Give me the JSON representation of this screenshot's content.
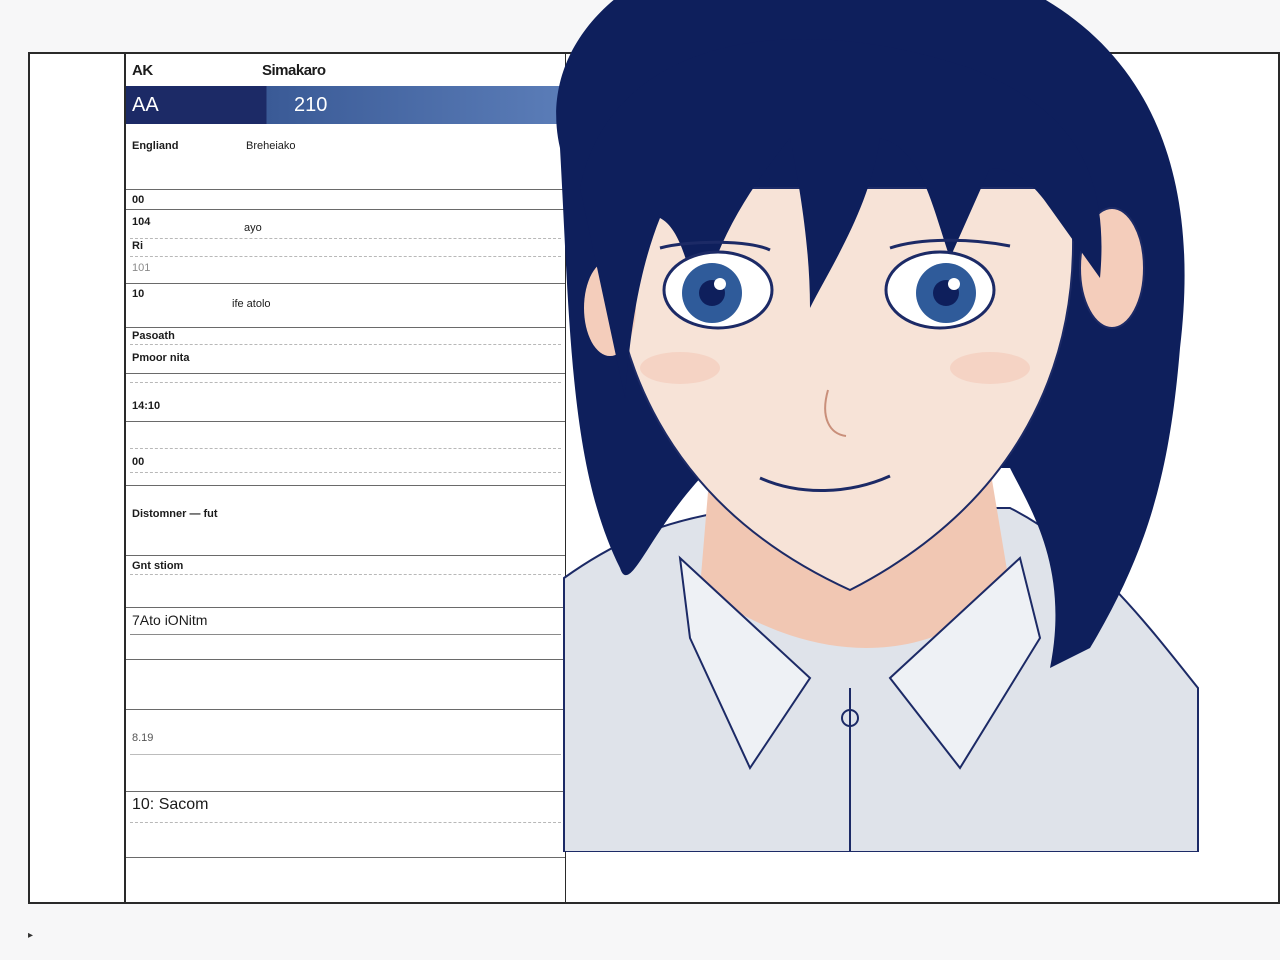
{
  "header": {
    "col1": "AK",
    "col2": "Simakaro"
  },
  "band": {
    "left": "AA",
    "right": "210"
  },
  "rows": [
    {
      "label": "Engliand",
      "value": "Breheiako"
    },
    {
      "label": "00",
      "value": ""
    },
    {
      "label": "104",
      "value": "ayo"
    },
    {
      "label": "Ri",
      "value": ""
    },
    {
      "label": "101",
      "value": ""
    },
    {
      "label": "10",
      "value": "ife atolo"
    },
    {
      "label": "Pasoath",
      "value": ""
    },
    {
      "label": "Pmoor nita",
      "value": ""
    },
    {
      "label": "14:10",
      "value": ""
    },
    {
      "label": "00",
      "value": ""
    },
    {
      "label": "Distomner — fut",
      "value": ""
    },
    {
      "label": "Gnt stiom",
      "value": ""
    },
    {
      "label": "7Ato iONitm",
      "value": ""
    },
    {
      "label": "8.19",
      "value": ""
    },
    {
      "label": "10: Sacom",
      "value": ""
    }
  ],
  "status": {
    "glyph": "▸"
  },
  "colors": {
    "navy": "#1c2a66",
    "band_light": "#5b7db8",
    "hair": "#0e1f5c",
    "skin": "#f7e3d7",
    "shirt": "#dfe3ea",
    "eye": "#2f5b9a"
  }
}
